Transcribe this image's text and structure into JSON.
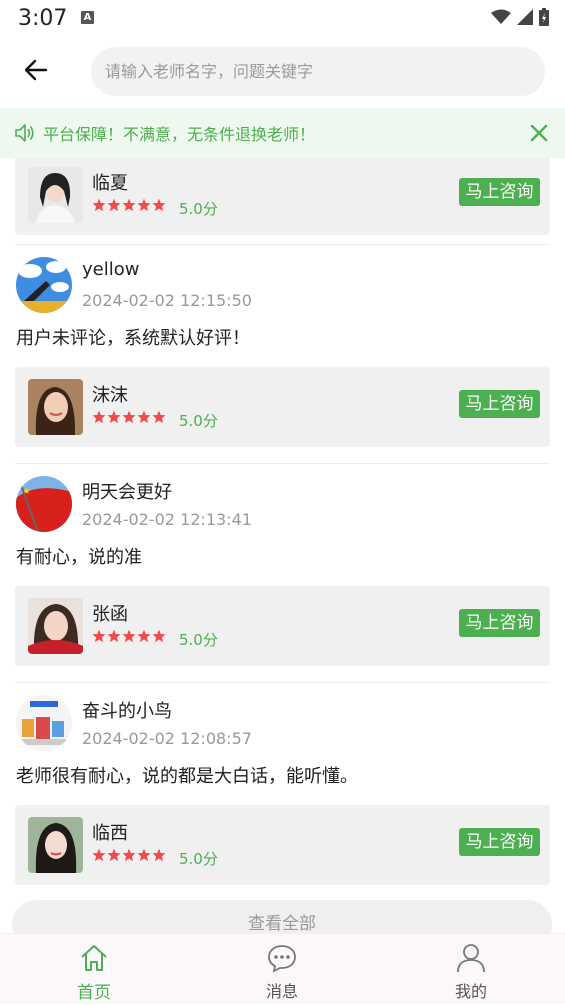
{
  "status": {
    "time": "3:07"
  },
  "search": {
    "placeholder": "请输入老师名字，问题关键字"
  },
  "notice": {
    "text": "平台保障！不满意，无条件退换老师！"
  },
  "consult_label": "马上咨询",
  "reviews": [
    {
      "teacher": {
        "name": "临夏",
        "rating": 5.0,
        "score_text": "5.0分"
      }
    },
    {
      "user": "yellow",
      "time": "2024-02-02 12:15:50",
      "comment": "用户未评论，系统默认好评！",
      "teacher": {
        "name": "沫沫",
        "rating": 5.0,
        "score_text": "5.0分"
      }
    },
    {
      "user": "明天会更好",
      "time": "2024-02-02 12:13:41",
      "comment": "有耐心，说的准",
      "teacher": {
        "name": "张函",
        "rating": 5.0,
        "score_text": "5.0分"
      }
    },
    {
      "user": "奋斗的小鸟",
      "time": "2024-02-02 12:08:57",
      "comment": "老师很有耐心，说的都是大白话，能听懂。",
      "teacher": {
        "name": "临西",
        "rating": 5.0,
        "score_text": "5.0分"
      }
    }
  ],
  "view_all": "查看全部",
  "tabs": [
    {
      "label": "首页",
      "active": true
    },
    {
      "label": "消息",
      "active": false
    },
    {
      "label": "我的",
      "active": false
    }
  ],
  "colors": {
    "accent": "#4caf50",
    "star": "#f04b4b",
    "notice_bg": "#eef8ee"
  }
}
